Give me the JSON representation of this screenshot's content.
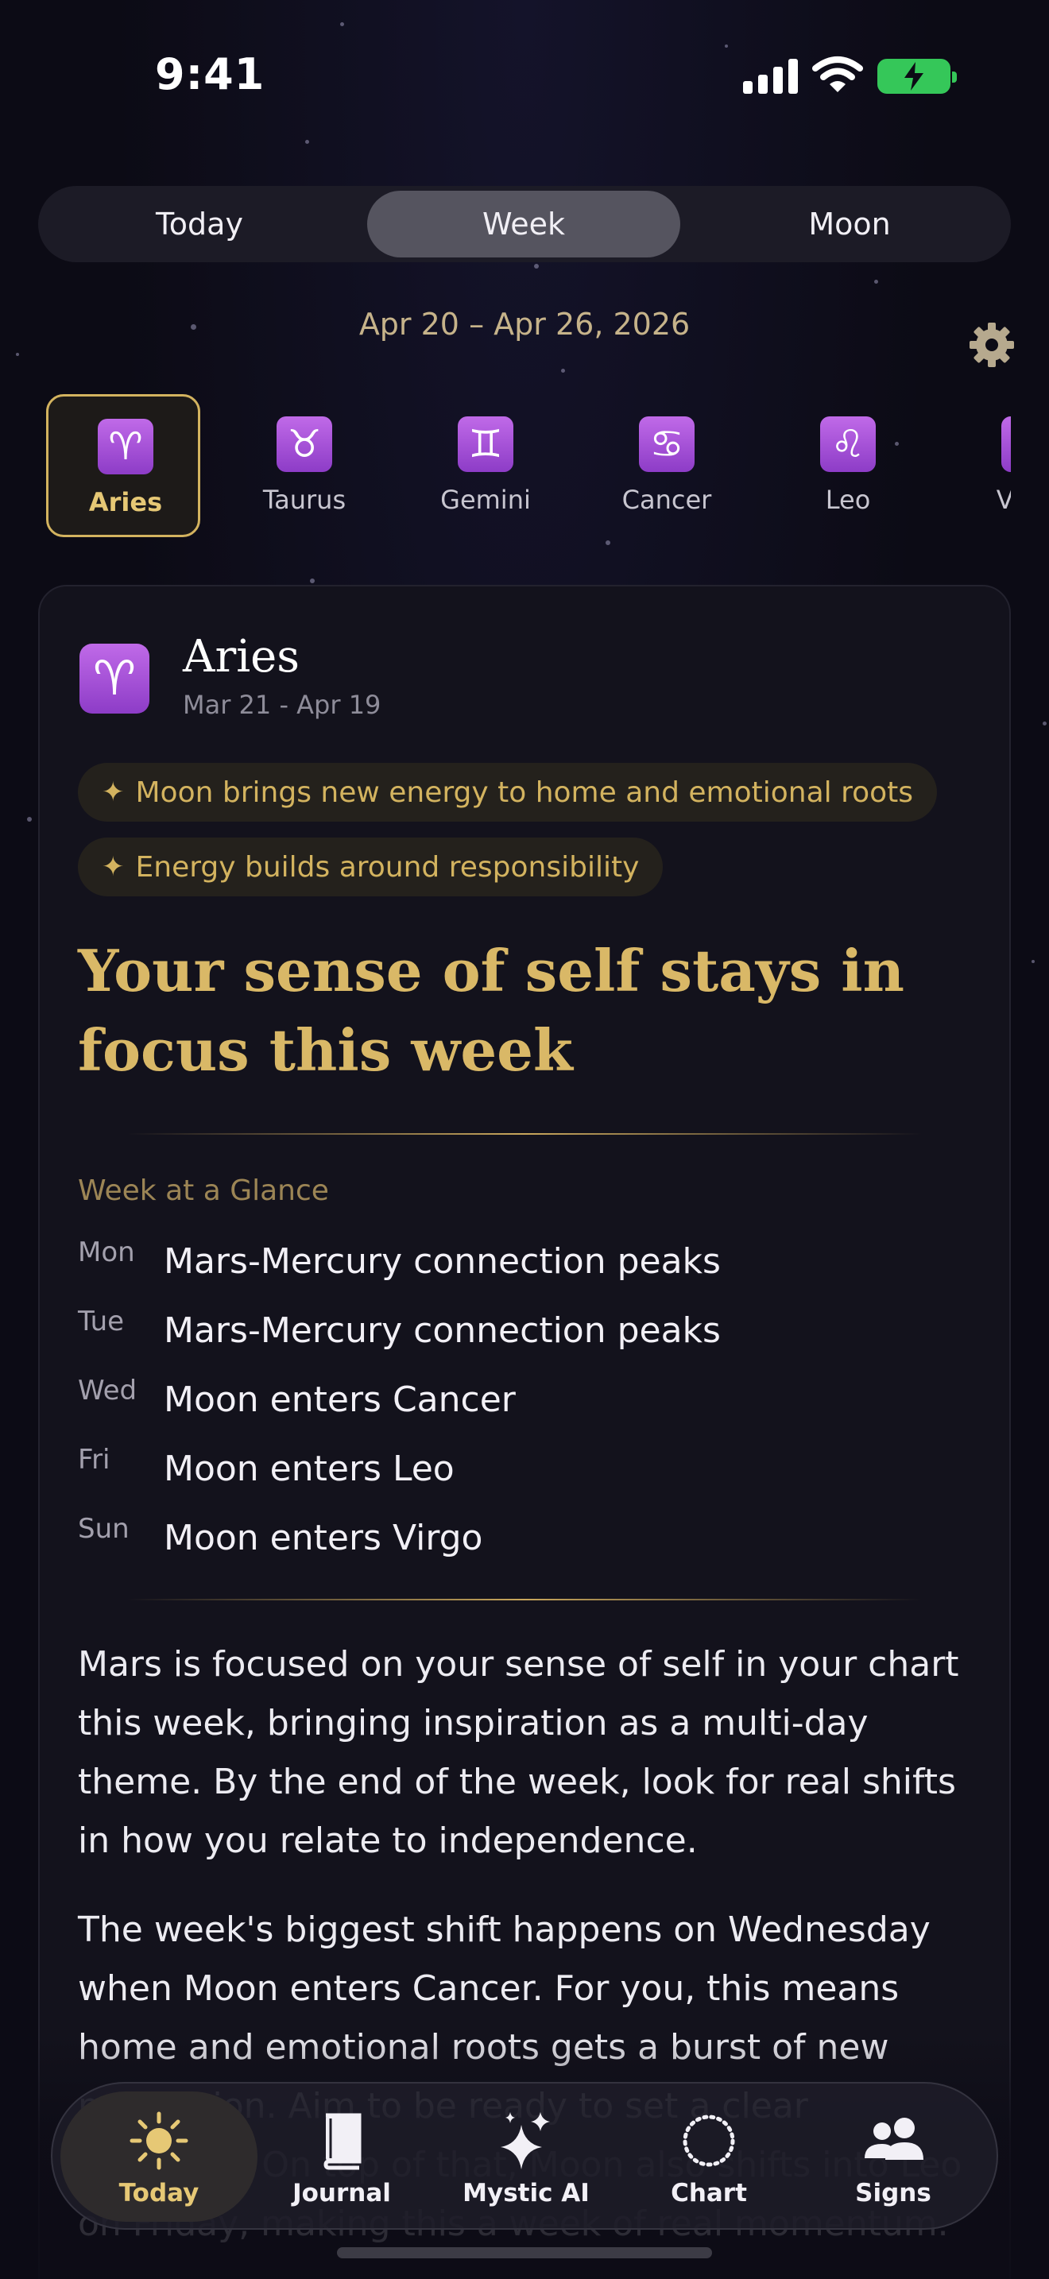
{
  "status_bar": {
    "time": "9:41"
  },
  "segmented_tabs": [
    {
      "label": "Today",
      "active": false
    },
    {
      "label": "Week",
      "active": true
    },
    {
      "label": "Moon",
      "active": false
    }
  ],
  "date_range": "Apr 20 – Apr 26, 2026",
  "settings_icon": "gear-icon",
  "signs": [
    {
      "glyph": "♈",
      "label": "Aries",
      "selected": true
    },
    {
      "glyph": "♉",
      "label": "Taurus",
      "selected": false
    },
    {
      "glyph": "♊",
      "label": "Gemini",
      "selected": false
    },
    {
      "glyph": "♋",
      "label": "Cancer",
      "selected": false
    },
    {
      "glyph": "♌",
      "label": "Leo",
      "selected": false
    },
    {
      "glyph": "♍",
      "label": "Virgo",
      "selected": false
    }
  ],
  "card": {
    "glyph": "♈",
    "sign_name": "Aries",
    "sign_dates": "Mar 21 - Apr 19",
    "highlights": [
      "Moon brings new energy to home and emotional roots",
      "Energy builds around responsibility"
    ],
    "headline": "Your sense of self stays in focus this week",
    "glance_title": "Week at a Glance",
    "glance": [
      {
        "day": "Mon",
        "event": "Mars-Mercury connection peaks"
      },
      {
        "day": "Tue",
        "event": "Mars-Mercury connection peaks"
      },
      {
        "day": "Wed",
        "event": "Moon enters Cancer"
      },
      {
        "day": "Fri",
        "event": "Moon enters Leo"
      },
      {
        "day": "Sun",
        "event": "Moon enters Virgo"
      }
    ],
    "paragraphs": [
      "Mars is focused on your sense of self in your chart this week, bringing inspiration as a multi-day theme. By the end of the week, look for real shifts in how you relate to independence.",
      "The week's biggest shift happens on Wednesday when Moon enters Cancer. For you, this means home and emotional roots gets a burst of new motivation. Aim to be ready to set a clear boundary. On top of that, Moon also shifts into Leo on Friday, making this a week of real momentum."
    ]
  },
  "bottom_nav": [
    {
      "label": "Today",
      "icon": "sun-icon",
      "active": true
    },
    {
      "label": "Journal",
      "icon": "book-icon",
      "active": false
    },
    {
      "label": "Mystic AI",
      "icon": "sparkles-icon",
      "active": false
    },
    {
      "label": "Chart",
      "icon": "chart-circle-icon",
      "active": false
    },
    {
      "label": "Signs",
      "icon": "people-icon",
      "active": false
    }
  ],
  "colors": {
    "accent_gold": "#d9b867",
    "sign_purple": "#a64fdc",
    "background": "#0c0b15"
  }
}
